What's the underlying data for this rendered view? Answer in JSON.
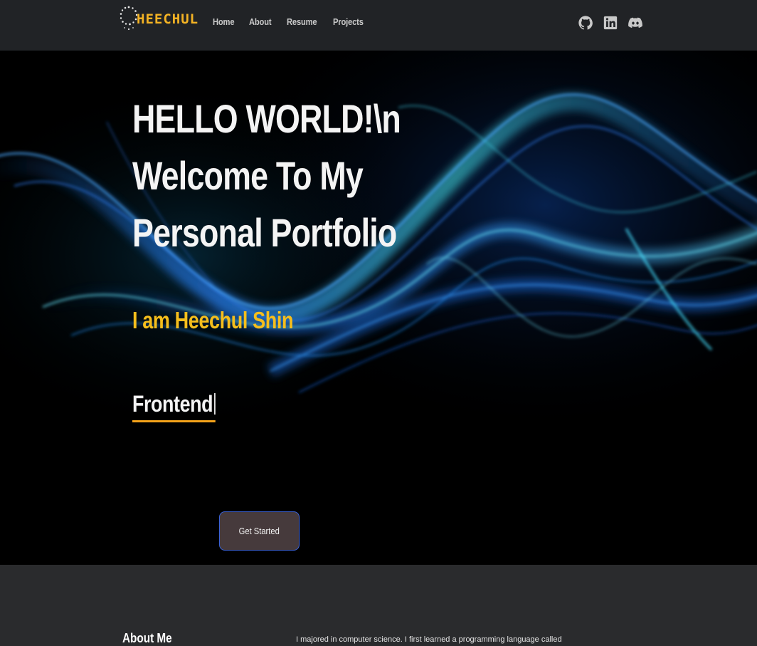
{
  "brand": {
    "name": "HEECHUL",
    "color": "#f4b324"
  },
  "nav": {
    "links": [
      {
        "label": "Home"
      },
      {
        "label": "About"
      },
      {
        "label": "Resume"
      },
      {
        "label": "Projects"
      }
    ],
    "socials": [
      {
        "icon": "github-icon"
      },
      {
        "icon": "linkedin-icon"
      },
      {
        "icon": "discord-icon"
      }
    ]
  },
  "hero": {
    "title_lines": [
      "HELLO WORLD!\\n",
      "Welcome To My",
      "Personal Portfolio"
    ],
    "intro": "I am Heechul Shin",
    "typed_text": "Frontend",
    "cta_label": "Get Started"
  },
  "about": {
    "title": "About Me",
    "text": "I majored in computer science. I first learned a programming language called"
  },
  "colors": {
    "navbar_bg": "#212326",
    "hero_bg": "#000000",
    "accent_yellow": "#f5be1c",
    "underline_orange": "#f3a21a",
    "button_bg": "#463a3c",
    "button_border": "#3b63d8",
    "section_bg": "#2a2b2d"
  }
}
